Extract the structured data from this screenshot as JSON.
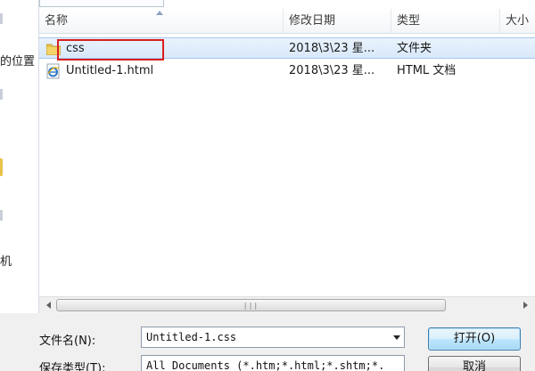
{
  "nav": {
    "fragment_location": "的位置",
    "fragment_bottom": "机"
  },
  "columns": {
    "name": "名称",
    "modified": "修改日期",
    "type": "类型",
    "size": "大小"
  },
  "files": [
    {
      "name": "css",
      "modified": "2018\\3\\23 星...",
      "type": "文件夹",
      "icon": "folder-icon",
      "selected": true
    },
    {
      "name": "Untitled-1.html",
      "modified": "2018\\3\\23 星...",
      "type": "HTML 文档",
      "icon": "ie-html-file-icon",
      "selected": false
    }
  ],
  "form": {
    "filename_label": "文件名(N):",
    "filename_value": "Untitled-1.css",
    "filetype_label": "保存类型(T):",
    "filetype_value": "All Documents (*.htm;*.html;*.shtm;*.",
    "open_button": "打开(O)",
    "cancel_button": "取消"
  },
  "colors": {
    "selection_fill": "#d8e8fa",
    "highlight_border": "#d81f1f",
    "folder": "#e8c24a"
  }
}
